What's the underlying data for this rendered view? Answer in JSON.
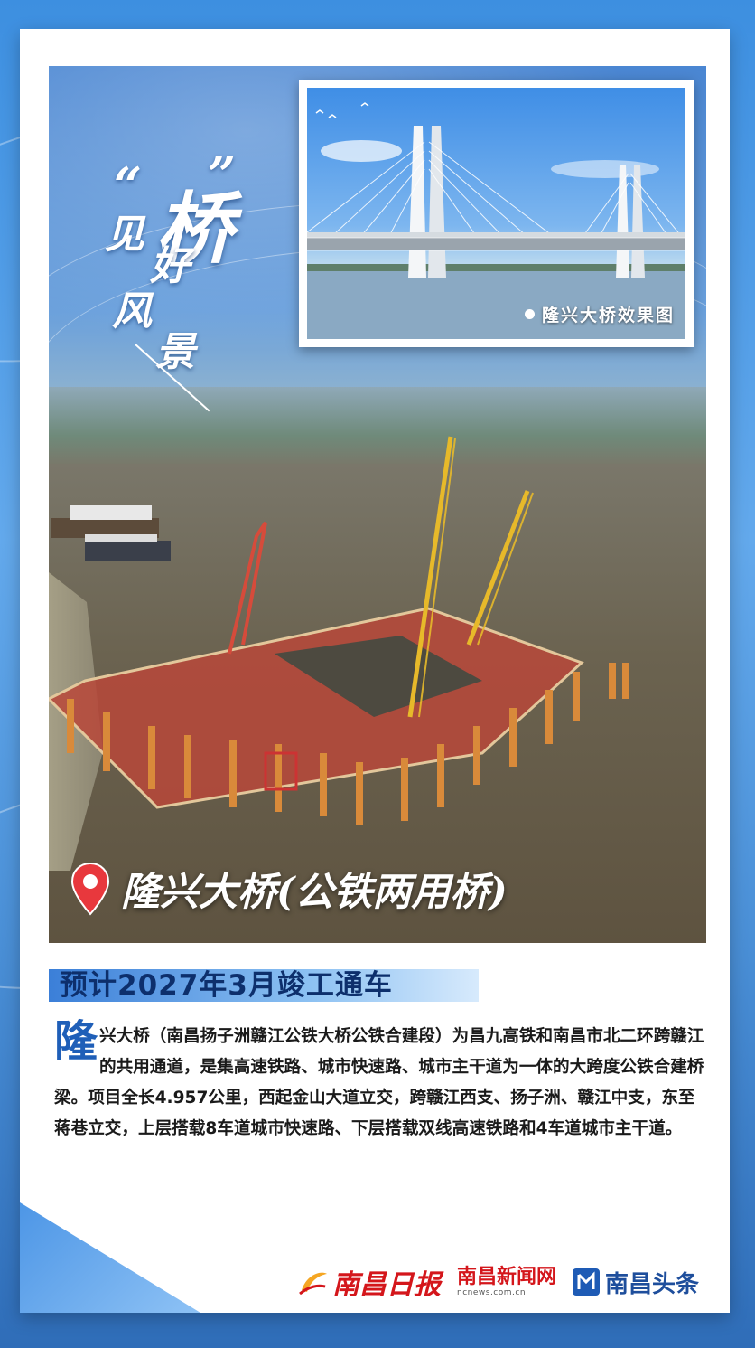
{
  "title": {
    "quote_open": "“",
    "main": "桥",
    "quote_close": "”",
    "sub_chars": [
      "见",
      "好",
      "风",
      "景"
    ]
  },
  "inset": {
    "caption": "隆兴大桥效果图"
  },
  "location": {
    "name": "隆兴大桥(公铁两用桥)",
    "icon": "map-pin-icon",
    "pin_color": "#e8383d"
  },
  "deadline": {
    "text": "预计2027年3月竣工通车"
  },
  "body": {
    "dropcap": "隆",
    "text": "兴大桥（南昌扬子洲赣江公铁大桥公铁合建段）为昌九高铁和南昌市北二环跨赣江的共用通道，是集高速铁路、城市快速路、城市主干道为一体的大跨度公铁合建桥梁。项目全长4.957公里，西起金山大道立交，跨赣江西支、扬子洲、赣江中支，东至蒋巷立交，上层搭载8车道城市快速路、下层搭载双线高速铁路和4车道城市主干道。"
  },
  "logos": {
    "nanchang_daily": "南昌日报",
    "news_site": "南昌新闻网",
    "news_site_url": "ncnews.com.cn",
    "toutiao": "南昌头条"
  },
  "colors": {
    "accent_blue": "#1f5fb8",
    "brand_red": "#d4161b",
    "deadline_text": "#0d2f6c"
  }
}
